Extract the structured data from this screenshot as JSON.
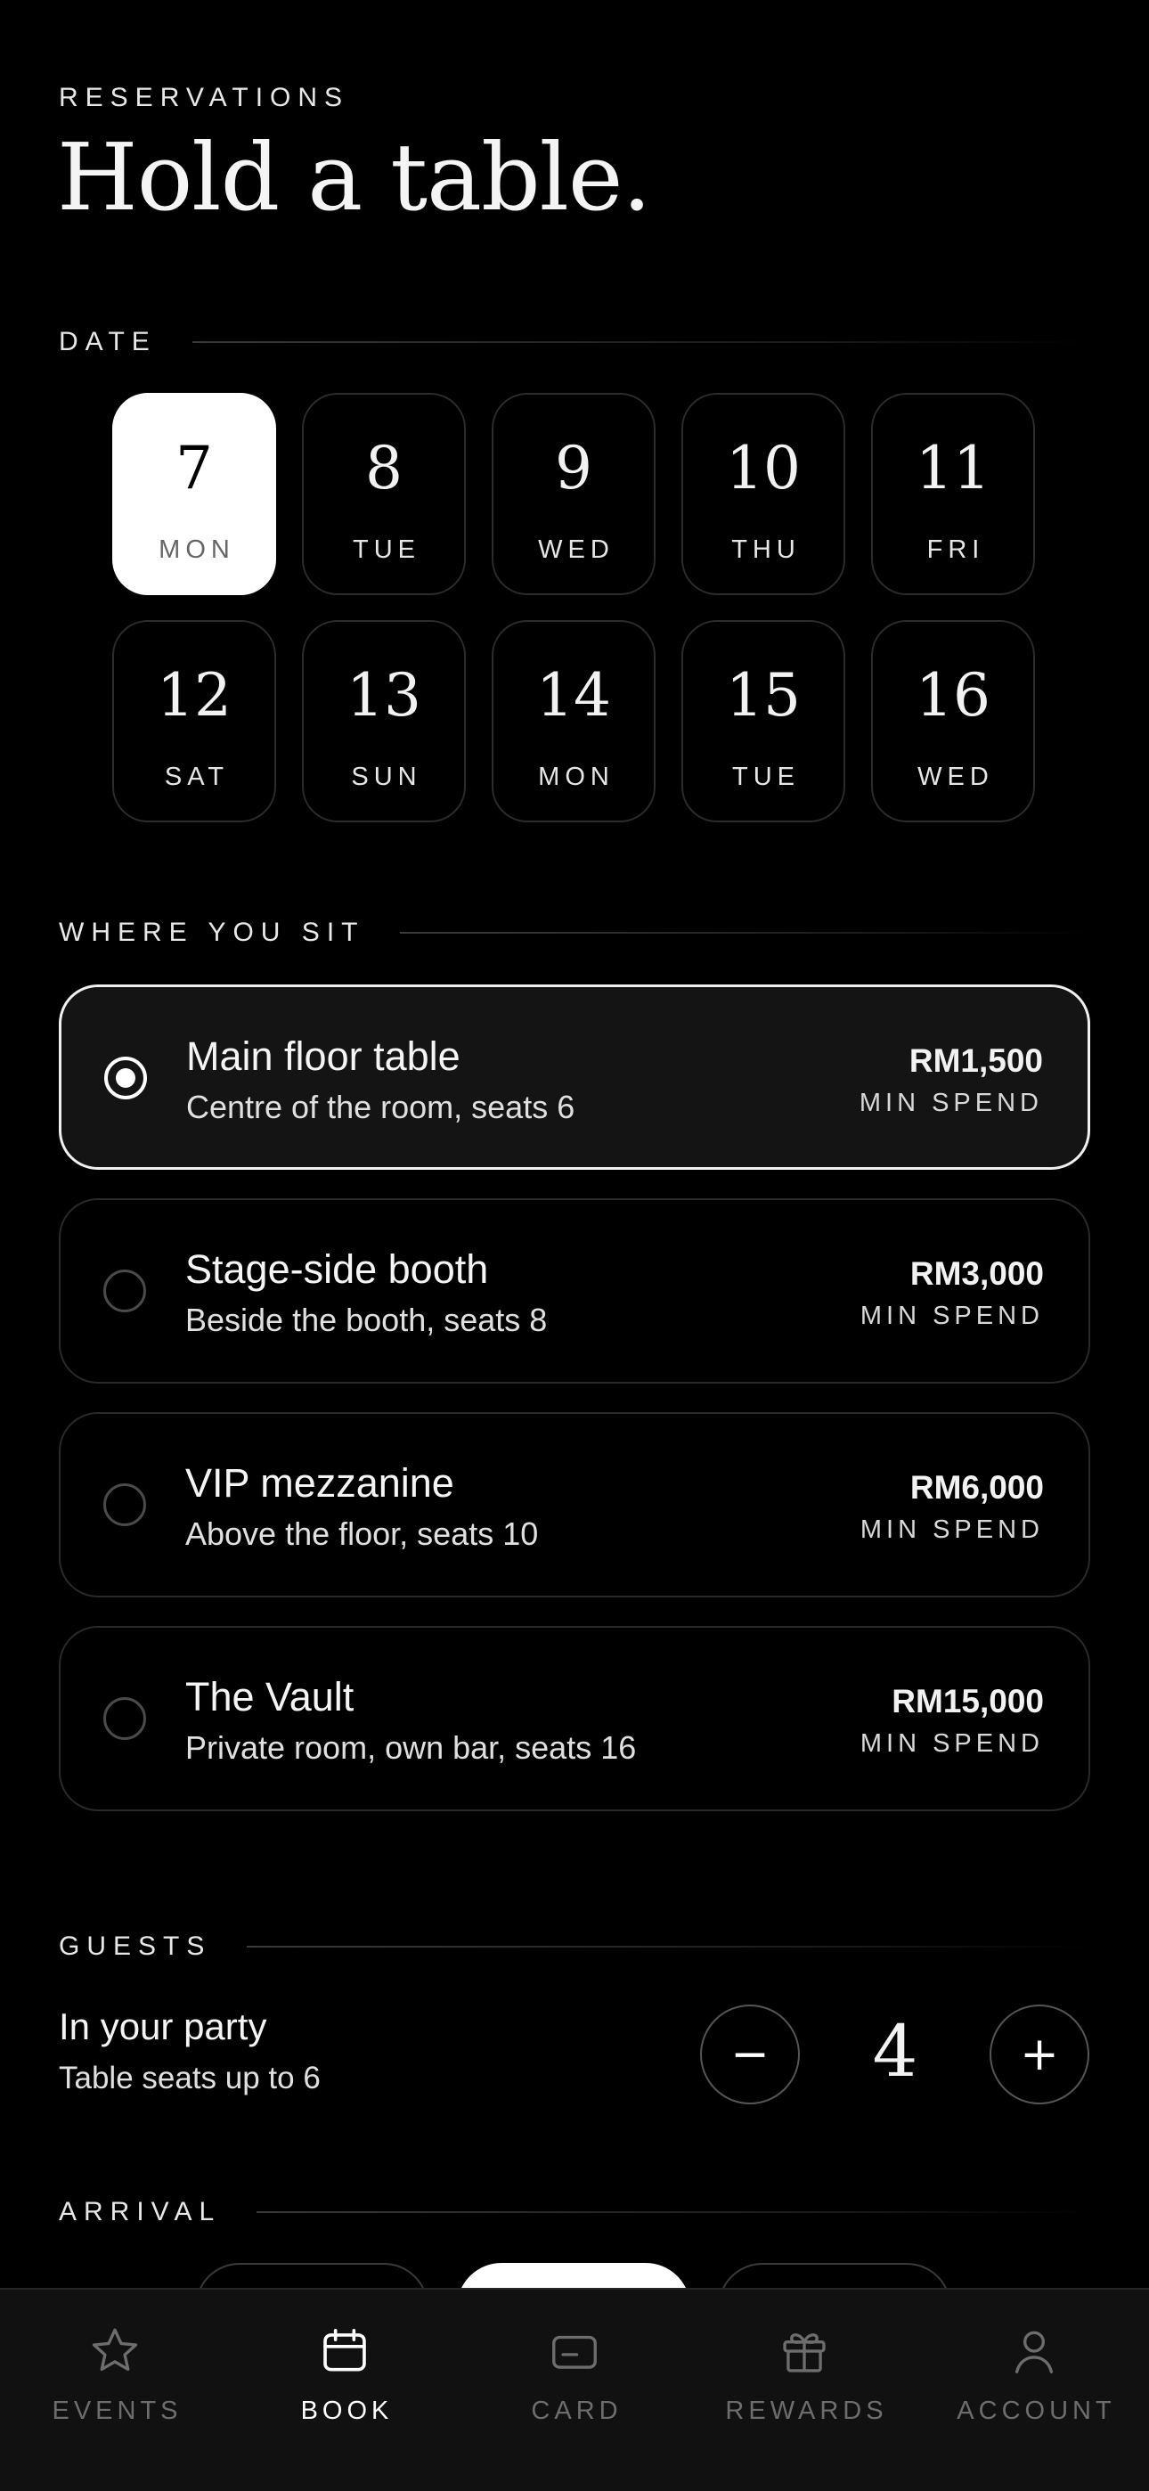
{
  "header": {
    "eyebrow": "RESERVATIONS",
    "title": "Hold a table."
  },
  "date_section": {
    "label": "DATE",
    "dates": [
      {
        "num": "7",
        "dow": "MON",
        "selected": true
      },
      {
        "num": "8",
        "dow": "TUE",
        "selected": false
      },
      {
        "num": "9",
        "dow": "WED",
        "selected": false
      },
      {
        "num": "10",
        "dow": "THU",
        "selected": false
      },
      {
        "num": "11",
        "dow": "FRI",
        "selected": false
      },
      {
        "num": "12",
        "dow": "SAT",
        "selected": false
      },
      {
        "num": "13",
        "dow": "SUN",
        "selected": false
      },
      {
        "num": "14",
        "dow": "MON",
        "selected": false
      },
      {
        "num": "15",
        "dow": "TUE",
        "selected": false
      },
      {
        "num": "16",
        "dow": "WED",
        "selected": false
      }
    ]
  },
  "seating_section": {
    "label": "WHERE YOU SIT",
    "options": [
      {
        "name": "Main floor table",
        "desc": "Centre of the room, seats 6",
        "price": "RM1,500",
        "min_label": "MIN SPEND",
        "selected": true
      },
      {
        "name": "Stage-side booth",
        "desc": "Beside the booth, seats 8",
        "price": "RM3,000",
        "min_label": "MIN SPEND",
        "selected": false
      },
      {
        "name": "VIP mezzanine",
        "desc": "Above the floor, seats 10",
        "price": "RM6,000",
        "min_label": "MIN SPEND",
        "selected": false
      },
      {
        "name": "The Vault",
        "desc": "Private room, own bar, seats 16",
        "price": "RM15,000",
        "min_label": "MIN SPEND",
        "selected": false
      }
    ]
  },
  "guests_section": {
    "label": "GUESTS",
    "title": "In your party",
    "subtitle": "Table seats up to 6",
    "count": "4",
    "minus_label": "−",
    "plus_label": "+"
  },
  "arrival_section": {
    "label": "ARRIVAL"
  },
  "tabbar": {
    "tabs": [
      {
        "label": "EVENTS",
        "icon": "star-icon",
        "active": false
      },
      {
        "label": "BOOK",
        "icon": "calendar-icon",
        "active": true
      },
      {
        "label": "CARD",
        "icon": "card-icon",
        "active": false
      },
      {
        "label": "REWARDS",
        "icon": "gift-icon",
        "active": false
      },
      {
        "label": "ACCOUNT",
        "icon": "person-icon",
        "active": false
      }
    ]
  }
}
